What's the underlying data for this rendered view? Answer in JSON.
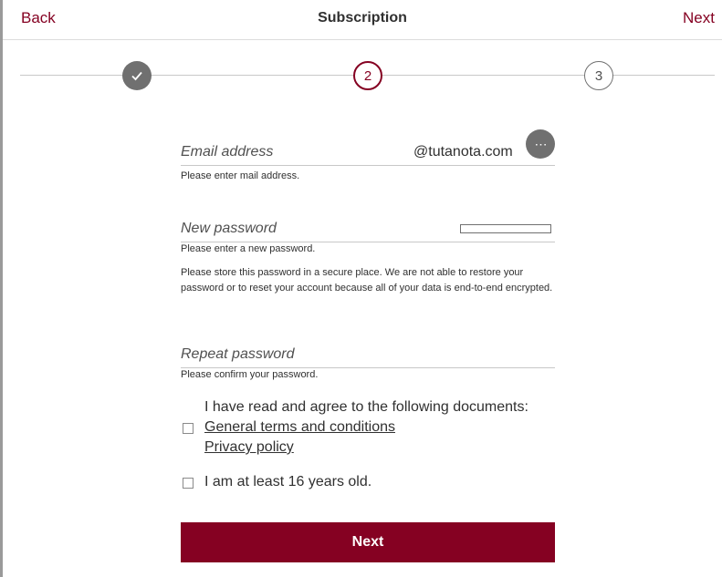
{
  "header": {
    "back_label": "Back",
    "title": "Subscription",
    "next_label": "Next"
  },
  "stepper": {
    "steps": [
      {
        "label": "✓",
        "state": "done"
      },
      {
        "label": "2",
        "state": "active"
      },
      {
        "label": "3",
        "state": "todo"
      }
    ]
  },
  "form": {
    "email": {
      "label": "Email address",
      "value": "",
      "domain_suffix": "@tutanota.com",
      "more_icon": "⋯",
      "helper": "Please enter mail address."
    },
    "new_password": {
      "label": "New password",
      "value": "",
      "helper": "Please enter a new password.",
      "strength_percent": 0
    },
    "info_text": "Please store this password in a secure place. We are not able to restore your password or to reset your account because all of your data is end-to-end encrypted.",
    "repeat_password": {
      "label": "Repeat password",
      "value": "",
      "helper": "Please confirm your password."
    },
    "terms": {
      "checked": false,
      "intro": "I have read and agree to the following documents:",
      "links": [
        "General terms and conditions",
        "Privacy policy"
      ]
    },
    "age": {
      "checked": false,
      "label": "I am at least 16 years old."
    },
    "submit_label": "Next"
  },
  "colors": {
    "accent": "#850122",
    "step_done": "#707070",
    "divider": "#c8c8c8"
  }
}
